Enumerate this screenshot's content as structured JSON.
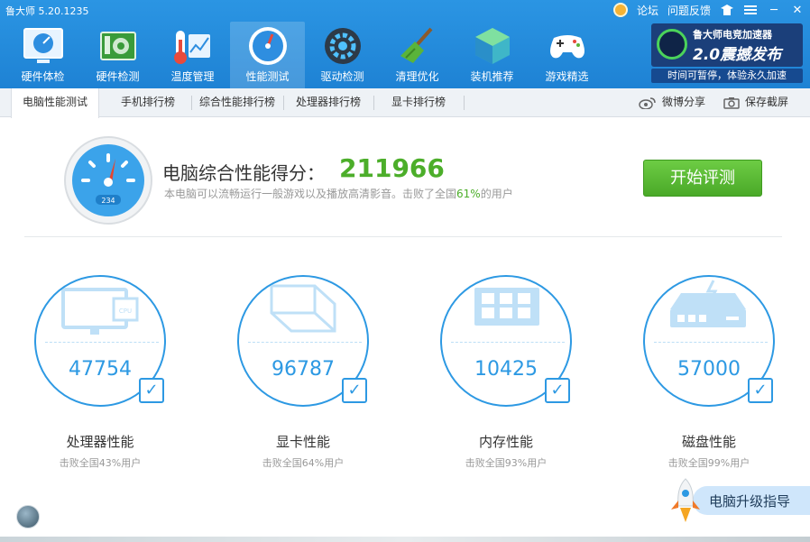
{
  "app": {
    "title": "鲁大师 5.20.1235"
  },
  "top_links": {
    "forum": "论坛",
    "feedback": "问题反馈"
  },
  "nav": [
    {
      "label": "硬件体检",
      "icon": "hardware-check-icon"
    },
    {
      "label": "硬件检测",
      "icon": "hardware-detect-icon"
    },
    {
      "label": "温度管理",
      "icon": "temperature-icon"
    },
    {
      "label": "性能测试",
      "icon": "performance-gauge-icon",
      "active": true
    },
    {
      "label": "驱动检测",
      "icon": "driver-gear-icon"
    },
    {
      "label": "清理优化",
      "icon": "broom-icon"
    },
    {
      "label": "装机推荐",
      "icon": "cube-icon"
    },
    {
      "label": "游戏精选",
      "icon": "gamepad-icon"
    }
  ],
  "promo": {
    "line1": "鲁大师电竞加速器",
    "line2": "2.0震撼发布",
    "line3": "时间可暂停，体验永久加速"
  },
  "tabs": [
    {
      "label": "电脑性能测试",
      "active": true
    },
    {
      "label": "手机排行榜"
    },
    {
      "label": "综合性能排行榜"
    },
    {
      "label": "处理器排行榜"
    },
    {
      "label": "显卡排行榜"
    }
  ],
  "tab_actions": {
    "weibo_share": "微博分享",
    "save_screenshot": "保存截屏"
  },
  "score": {
    "title": "电脑综合性能得分：",
    "value": "211966",
    "desc_prefix": "本电脑可以流畅运行一般游戏以及播放高清影音。击败了全国",
    "desc_pct": "61%",
    "desc_suffix": "的用户",
    "gauge_text": "234"
  },
  "start_button": "开始评测",
  "metrics": [
    {
      "name": "处理器性能",
      "value": "47754",
      "sub": "击败全国43%用户",
      "icon": "monitor-cpu-icon"
    },
    {
      "name": "显卡性能",
      "value": "96787",
      "sub": "击败全国64%用户",
      "icon": "gpu-cube-icon"
    },
    {
      "name": "内存性能",
      "value": "10425",
      "sub": "击败全国93%用户",
      "icon": "memory-chip-icon"
    },
    {
      "name": "磁盘性能",
      "value": "57000",
      "sub": "击败全国99%用户",
      "icon": "disk-drive-icon"
    }
  ],
  "upgrade_guide": "电脑升级指导",
  "colors": {
    "header": "#1e82d4",
    "accent": "#2d99e3",
    "green": "#4cae2a"
  }
}
